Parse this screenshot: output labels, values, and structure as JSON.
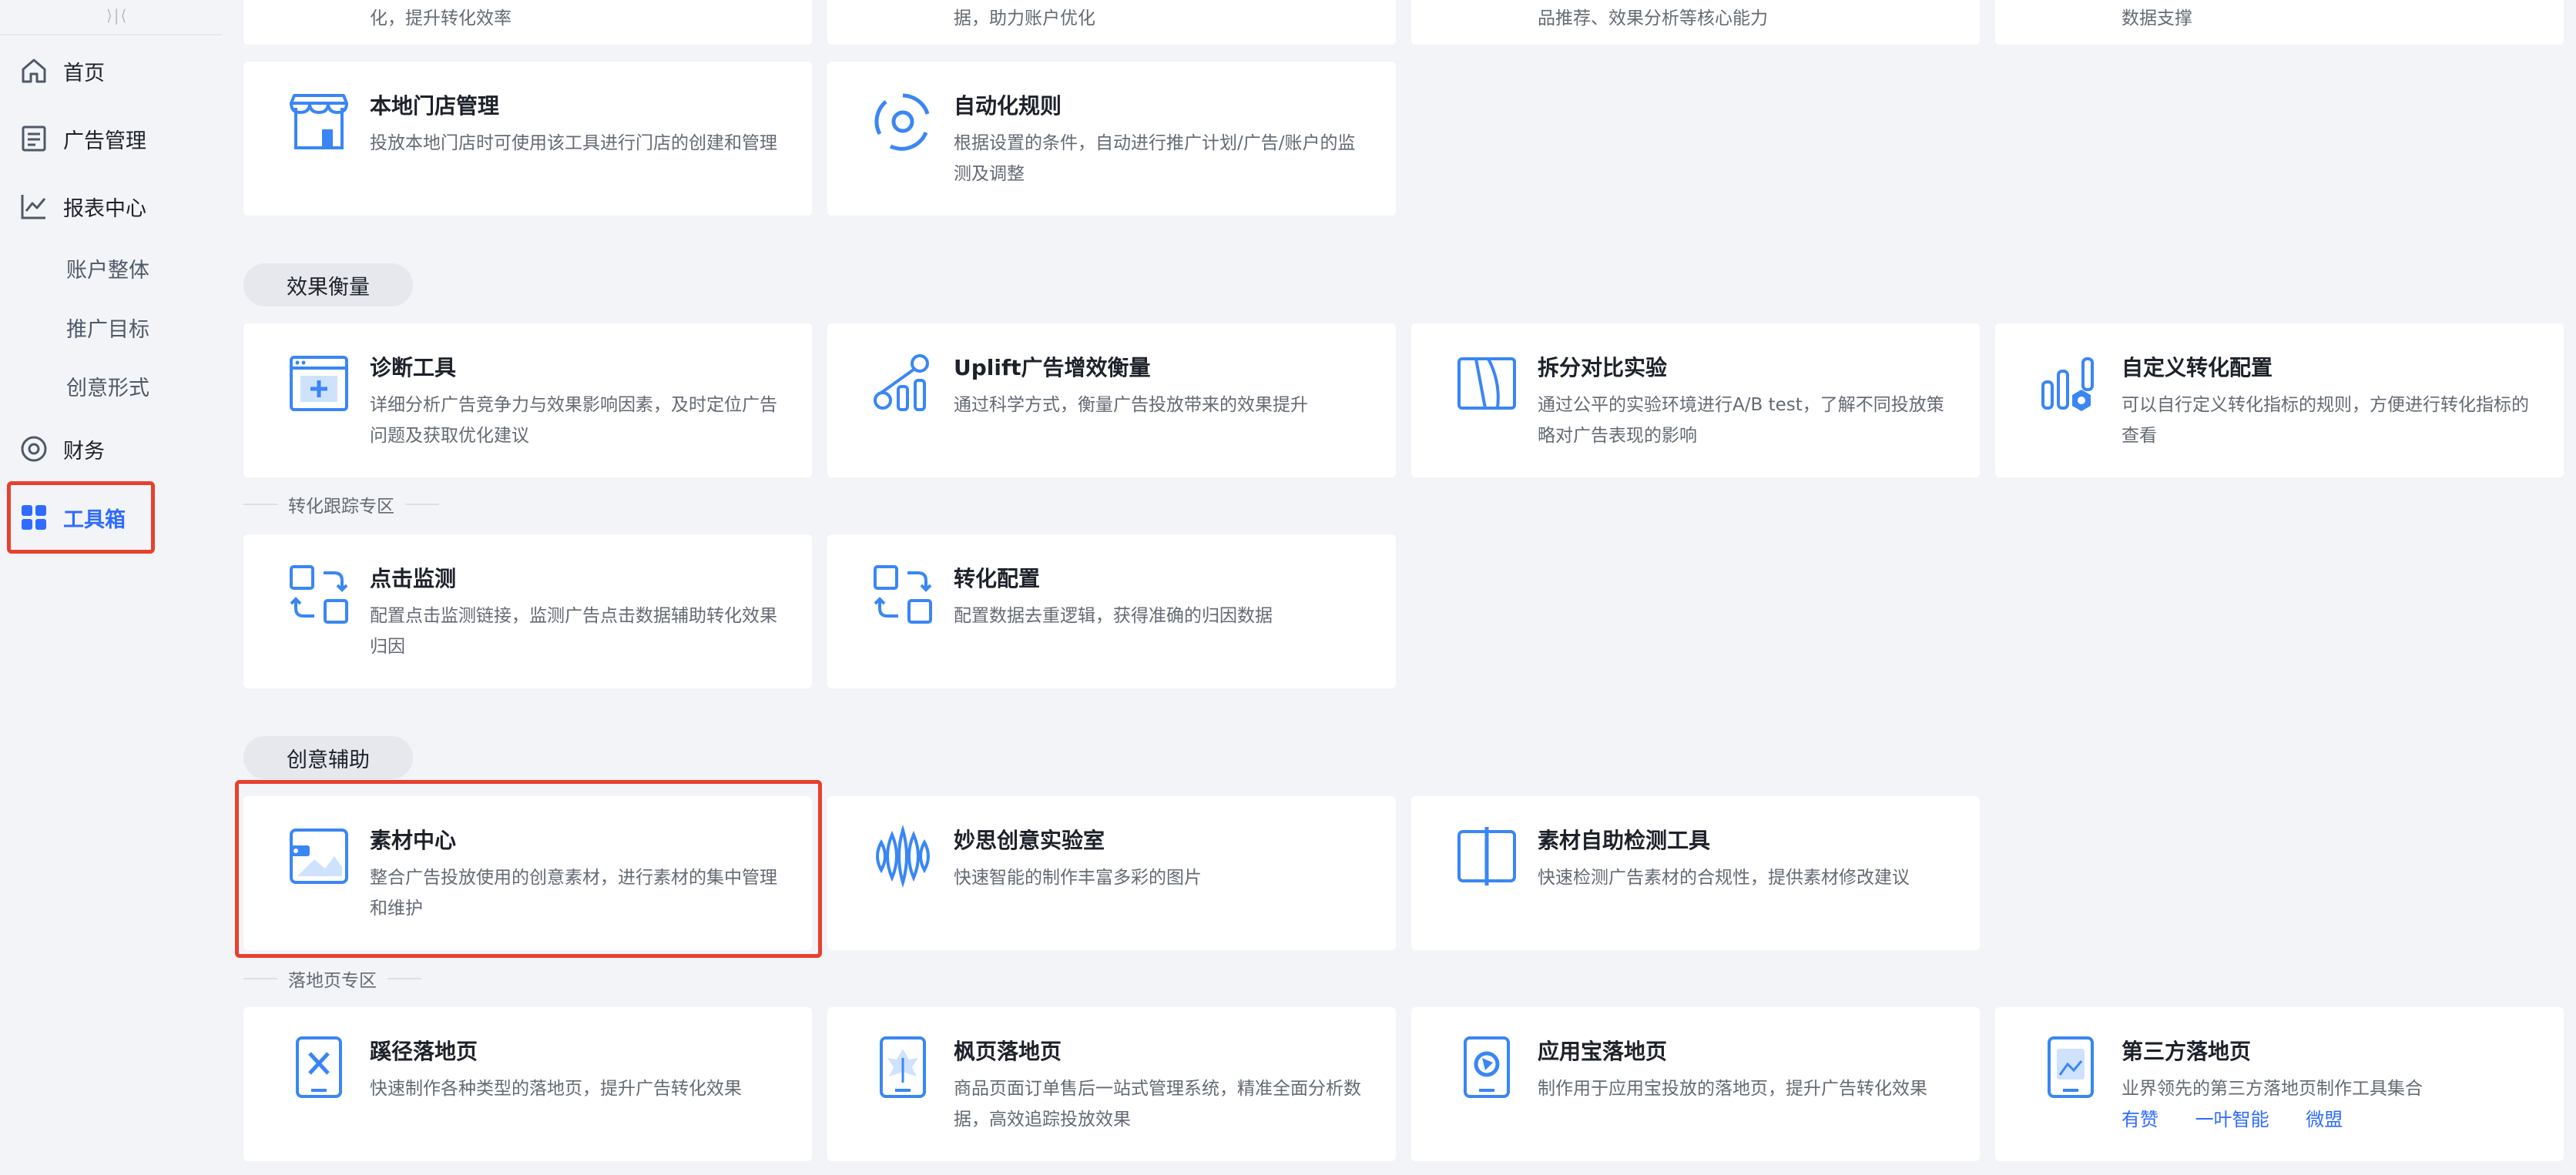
{
  "sidebar": {
    "collapse_glyph": "⟩|⟨",
    "items": [
      {
        "label": "首页",
        "icon": "home-icon"
      },
      {
        "label": "广告管理",
        "icon": "document-icon"
      },
      {
        "label": "报表中心",
        "icon": "line-chart-icon"
      },
      {
        "label": "账户整体"
      },
      {
        "label": "推广目标"
      },
      {
        "label": "创意形式"
      },
      {
        "label": "财务",
        "icon": "coin-icon"
      },
      {
        "label": "工具箱",
        "icon": "grid-icon",
        "active": true
      }
    ]
  },
  "top_partial": [
    {
      "desc": "化，提升转化效率"
    },
    {
      "desc": "据，助力账户优化"
    },
    {
      "desc": "品推荐、效果分析等核心能力"
    },
    {
      "desc": "数据支撑"
    }
  ],
  "top_cards": [
    {
      "title": "本地门店管理",
      "desc": "投放本地门店时可使用该工具进行门店的创建和管理",
      "icon": "store-icon"
    },
    {
      "title": "自动化规则",
      "desc": "根据设置的条件，自动进行推广计划/广告/账户的监测及调整",
      "icon": "auto-rule-icon"
    }
  ],
  "sections": {
    "effect": {
      "label": "效果衡量",
      "cards": [
        {
          "title": "诊断工具",
          "desc": "详细分析广告竞争力与效果影响因素，及时定位广告问题及获取优化建议",
          "icon": "diagnosis-icon"
        },
        {
          "title": "Uplift广告增效衡量",
          "desc": "通过科学方式，衡量广告投放带来的效果提升",
          "icon": "uplift-icon"
        },
        {
          "title": "拆分对比实验",
          "desc": "通过公平的实验环境进行A/B test，了解不同投放策略对广告表现的影响",
          "icon": "ab-test-icon"
        },
        {
          "title": "自定义转化配置",
          "desc": "可以自行定义转化指标的规则，方便进行转化指标的查看",
          "icon": "custom-conversion-icon"
        }
      ]
    },
    "conversion": {
      "label": "转化跟踪专区",
      "cards": [
        {
          "title": "点击监测",
          "desc": "配置点击监测链接，监测广告点击数据辅助转化效果归因",
          "icon": "click-monitor-icon"
        },
        {
          "title": "转化配置",
          "desc": "配置数据去重逻辑，获得准确的归因数据",
          "icon": "conversion-config-icon"
        }
      ]
    },
    "creative": {
      "label": "创意辅助",
      "cards": [
        {
          "title": "素材中心",
          "desc": "整合广告投放使用的创意素材，进行素材的集中管理和维护",
          "icon": "material-center-icon"
        },
        {
          "title": "妙思创意实验室",
          "desc": "快速智能的制作丰富多彩的图片",
          "icon": "creative-lab-icon"
        },
        {
          "title": "素材自助检测工具",
          "desc": "快速检测广告素材的合规性，提供素材修改建议",
          "icon": "material-check-icon"
        }
      ]
    },
    "landing": {
      "label": "落地页专区",
      "cards": [
        {
          "title": "蹊径落地页",
          "desc": "快速制作各种类型的落地页，提升广告转化效果",
          "icon": "xijing-page-icon"
        },
        {
          "title": "枫页落地页",
          "desc": "商品页面订单售后一站式管理系统，精准全面分析数据，高效追踪投放效果",
          "icon": "fengye-page-icon"
        },
        {
          "title": "应用宝落地页",
          "desc": "制作用于应用宝投放的落地页，提升广告转化效果",
          "icon": "yyb-page-icon"
        },
        {
          "title": "第三方落地页",
          "desc": "业界领先的第三方落地页制作工具集合",
          "icon": "third-party-page-icon",
          "links": [
            "有赞",
            "一叶智能",
            "微盟"
          ]
        }
      ]
    }
  },
  "colors": {
    "accent": "#2f6bff",
    "highlight": "#e8402f",
    "icon_blue": "#3a86f5"
  }
}
